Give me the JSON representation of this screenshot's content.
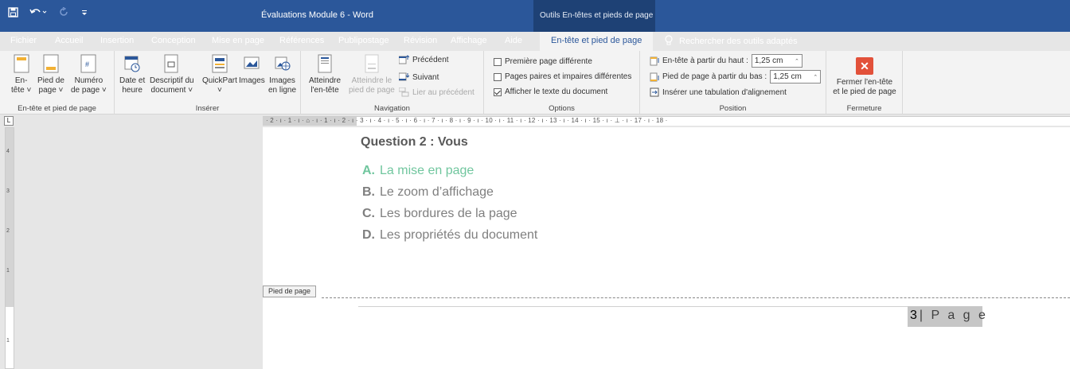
{
  "app": {
    "quick_access": [
      "save-icon",
      "undo-icon",
      "redo-icon",
      "customize-icon"
    ],
    "document_title": "Évaluations Module 6  -  Word",
    "contextual_title": "Outils En-têtes et pieds de page"
  },
  "tabs": [
    {
      "label": "Fichier"
    },
    {
      "label": "Accueil"
    },
    {
      "label": "Insertion"
    },
    {
      "label": "Conception"
    },
    {
      "label": "Mise en page"
    },
    {
      "label": "Références"
    },
    {
      "label": "Publipostage"
    },
    {
      "label": "Révision"
    },
    {
      "label": "Affichage"
    },
    {
      "label": "Aide"
    },
    {
      "label": "En-tête et pied de page"
    }
  ],
  "tell_me": {
    "label": "Rechercher des outils adaptés",
    "icon": "lightbulb-icon"
  },
  "ribbon": {
    "group_headerfooter": {
      "label": "En-tête et pied de page",
      "header_line1": "En-",
      "header_line2": "tête ˅",
      "footer_line1": "Pied de",
      "footer_line2": "page ˅",
      "pagenum_line1": "Numéro",
      "pagenum_line2": "de page ˅"
    },
    "group_insert": {
      "label": "Insérer",
      "date_line1": "Date et",
      "date_line2": "heure",
      "docinfo_line1": "Descriptif du",
      "docinfo_line2": "document ˅",
      "quickpart_line1": "QuickPart",
      "quickpart_line2": "˅",
      "images": "Images",
      "online_line1": "Images",
      "online_line2": "en ligne"
    },
    "group_navigation": {
      "label": "Navigation",
      "goto_header_line1": "Atteindre",
      "goto_header_line2": "l'en-tête",
      "goto_footer_line1": "Atteindre le",
      "goto_footer_line2": "pied de page",
      "previous": "Précédent",
      "next": "Suivant",
      "link_previous": "Lier au précédent"
    },
    "group_options": {
      "label": "Options",
      "different_first": "Première page différente",
      "different_odd_even": "Pages paires et impaires différentes",
      "show_doc_text": "Afficher le texte du document",
      "different_first_checked": false,
      "different_odd_even_checked": false,
      "show_doc_text_checked": true
    },
    "group_position": {
      "label": "Position",
      "header_from_top": "En-tête à partir du haut :",
      "header_value": "1,25 cm",
      "footer_from_bottom": "Pied de page à partir du bas :",
      "footer_value": "1,25 cm",
      "insert_tab": "Insérer une tabulation d'alignement"
    },
    "group_close": {
      "label": "Fermeture",
      "close_line1": "Fermer l'en-tête",
      "close_line2": "et le pied de page"
    }
  },
  "ruler": {
    "corner": "L",
    "text": "· 2 · ı · 1 · ı ·  ⌂  · ı · 1 · ı · 2 · ı · 3 · ı · 4 · ı · 5 · ı · 6 · ı · 7 · ı · 8 · ı · 9 · ı · 10 · ı · 11 · ı · 12 · ı · 13 · ı · 14 · ı · 15 · ı · ⊥ · ı · 17 · ı · 18 ·",
    "vertical_marks": [
      "4",
      "3",
      "2",
      "1",
      "1"
    ]
  },
  "document": {
    "question_title": "Question 2 : Vous",
    "answers": [
      {
        "letter": "A.",
        "text": "La mise en page"
      },
      {
        "letter": "B.",
        "text": "Le zoom d’affichage"
      },
      {
        "letter": "C.",
        "text": "Les bordures de la page"
      },
      {
        "letter": "D.",
        "text": "Les propriétés du document"
      }
    ],
    "correct_color": "#70c69e",
    "footer_tag": "Pied de page",
    "page_number": "3",
    "page_label": "| P a g e"
  }
}
